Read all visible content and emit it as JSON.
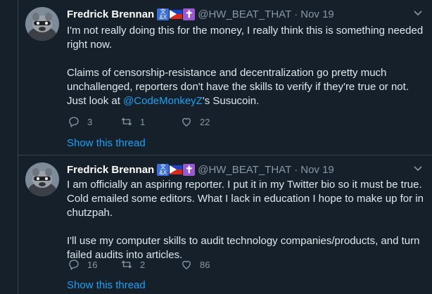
{
  "tweets": [
    {
      "author": {
        "name": "Fredrick Brennan",
        "handle": "@HW_BEAT_THAT",
        "badges": [
          "lang-badge-icon",
          "philippines-flag-icon",
          "latin-cross-icon"
        ],
        "badge_glyphs": {
          "lang": "文\n&Ｘ",
          "cross": "✝"
        }
      },
      "separator": "·",
      "date": "Nov 19",
      "body": [
        "I'm not really doing this for the money, I really think this is something needed right now.",
        {
          "before": "Claims of censorship-resistance and decentralization go pretty much unchallenged, reporters don't have the skills to verify if they're true or not. Just look at ",
          "mention": "@CodeMonkeyZ",
          "after": "'s Susucoin."
        }
      ],
      "replies": "3",
      "retweets": "1",
      "likes": "22",
      "show_thread": "Show this thread"
    },
    {
      "author": {
        "name": "Fredrick Brennan",
        "handle": "@HW_BEAT_THAT",
        "badges": [
          "lang-badge-icon",
          "philippines-flag-icon",
          "latin-cross-icon"
        ],
        "badge_glyphs": {
          "lang": "文\n&Ｘ",
          "cross": "✝"
        }
      },
      "separator": "·",
      "date": "Nov 19",
      "body": [
        "I am officially an aspiring reporter. I put it in my Twitter bio so it must be true. Cold emailed some editors. What I lack in education I hope to make up for in chutzpah.",
        "I'll use my computer skills to audit technology companies/products, and turn failed audits into articles."
      ],
      "replies": "16",
      "retweets": "2",
      "likes": "86",
      "show_thread": "Show this thread"
    }
  ],
  "colors": {
    "background": "#15202b",
    "text": "#e1e8ed",
    "muted": "#8899a6",
    "link": "#1da1f2",
    "divider": "#38444d"
  }
}
